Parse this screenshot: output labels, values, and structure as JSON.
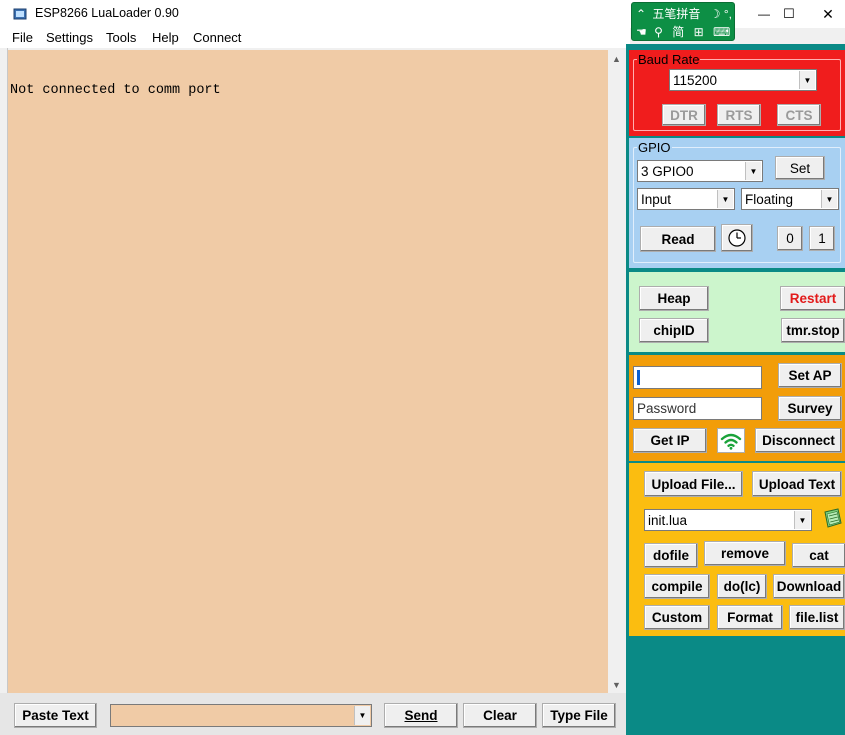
{
  "window": {
    "title": "ESP8266 LuaLoader 0.90",
    "minimize": "—",
    "maximize": "☐",
    "close": "✕"
  },
  "ime": {
    "row1": "五笔拼音",
    "row1_icons": "☽ °,",
    "row2": "简",
    "row2_extra": "⊞"
  },
  "menu": {
    "file": "File",
    "settings": "Settings",
    "tools": "Tools",
    "help": "Help",
    "connect": "Connect"
  },
  "terminal": {
    "text": "Not connected to comm port"
  },
  "bottom": {
    "paste_text": "Paste Text",
    "input_value": "",
    "send": "Send",
    "clear": "Clear",
    "type_file": "Type File"
  },
  "baud": {
    "label": "Baud Rate",
    "value": "115200",
    "dtr": "DTR",
    "rts": "RTS",
    "cts": "CTS"
  },
  "gpio": {
    "label": "GPIO",
    "pin": "3 GPIO0",
    "set": "Set",
    "mode": "Input",
    "pull": "Floating",
    "read": "Read",
    "zero": "0",
    "one": "1"
  },
  "misc": {
    "heap": "Heap",
    "restart": "Restart",
    "chipid": "chipID",
    "tmr_stop": "tmr.stop"
  },
  "wifi": {
    "ssid_value": "",
    "set_ap": "Set AP",
    "password_value": "Password",
    "survey": "Survey",
    "get_ip": "Get IP",
    "disconnect": "Disconnect"
  },
  "files": {
    "upload_file": "Upload File...",
    "upload_text": "Upload Text",
    "file_value": "init.lua",
    "dofile": "dofile",
    "remove": "remove",
    "cat": "cat",
    "compile": "compile",
    "do_lc": "do(lc)",
    "download": "Download",
    "custom": "Custom",
    "format": "Format",
    "file_list": "file.list"
  },
  "colors": {
    "terminal_bg": "#f0cba6",
    "right_bg": "#0a8a86",
    "baud_bg": "#f01d1d",
    "gpio_bg": "#a8d0f2",
    "misc_bg": "#ccf5cc",
    "wifi_bg": "#f29d09",
    "files_bg": "#fbbd10",
    "ime_bg": "#0d8f45"
  }
}
